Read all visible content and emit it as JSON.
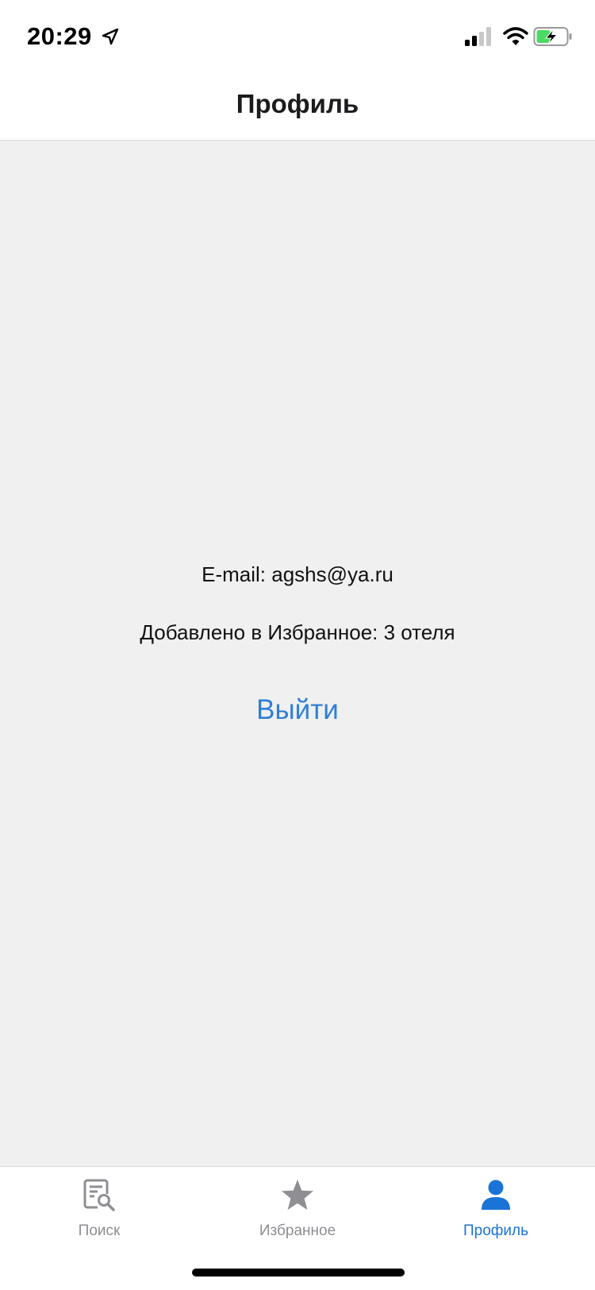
{
  "status_bar": {
    "time": "20:29",
    "icons": [
      "location-arrow-icon",
      "cellular-signal-icon",
      "wifi-icon",
      "battery-charging-icon"
    ]
  },
  "nav": {
    "title": "Профиль"
  },
  "profile": {
    "email_text": "E-mail: agshs@ya.ru",
    "favorites_text": "Добавлено в Избранное: 3 отеля",
    "logout_label": "Выйти"
  },
  "tabs": [
    {
      "label": "Поиск",
      "icon": "search-document-icon",
      "active": false
    },
    {
      "label": "Избранное",
      "icon": "star-icon",
      "active": false
    },
    {
      "label": "Профиль",
      "icon": "person-icon",
      "active": true
    }
  ],
  "colors": {
    "accent": "#1a73d6",
    "link": "#2f7fd4",
    "inactive": "#8e8e93",
    "background": "#f0f0f0",
    "battery_green": "#4cd964"
  }
}
